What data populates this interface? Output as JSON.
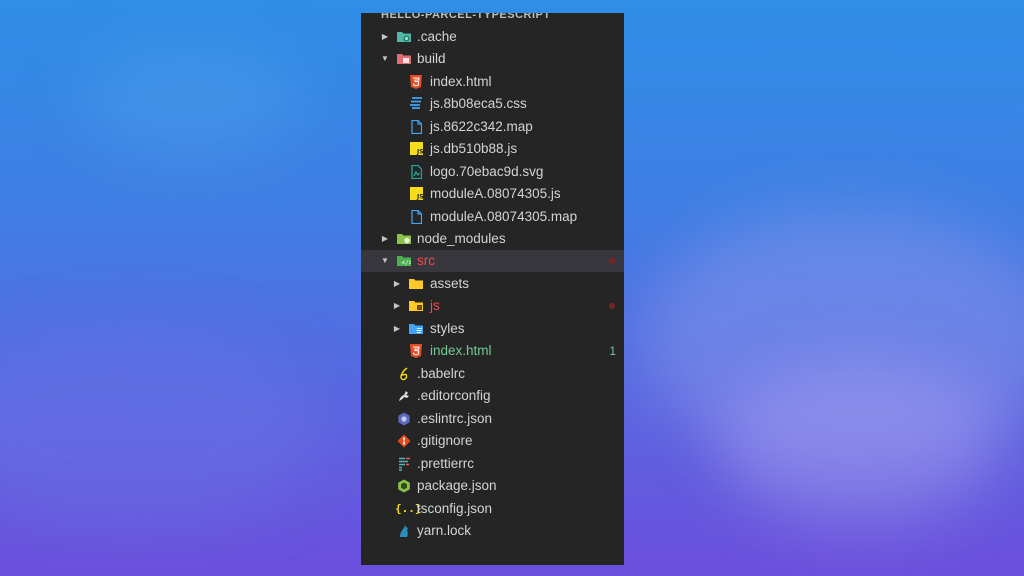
{
  "explorer": {
    "title": "HELLO-PARCEL-TYPESCRIPT",
    "items": [
      {
        "name": ".cache",
        "type": "folder",
        "twisty": "▸",
        "icon": "folder-cache-icon",
        "color": "#4fb8a8"
      },
      {
        "name": "build",
        "type": "folder",
        "twisty": "▾",
        "icon": "folder-build-icon",
        "color": "#e06c75"
      },
      {
        "name": "index.html",
        "type": "file",
        "icon": "html-icon",
        "color": "#e44d26"
      },
      {
        "name": "js.8b08eca5.css",
        "type": "file",
        "icon": "css-icon",
        "color": "#42a5f5"
      },
      {
        "name": "js.8622c342.map",
        "type": "file",
        "icon": "map-file-icon",
        "color": "#42a5f5"
      },
      {
        "name": "js.db510b88.js",
        "type": "file",
        "icon": "js-icon",
        "color": "#f5de19"
      },
      {
        "name": "logo.70ebac9d.svg",
        "type": "file",
        "icon": "svg-icon",
        "color": "#26a69a"
      },
      {
        "name": "moduleA.08074305.js",
        "type": "file",
        "icon": "js-icon",
        "color": "#f5de19"
      },
      {
        "name": "moduleA.08074305.map",
        "type": "file",
        "icon": "map-file-icon",
        "color": "#42a5f5"
      },
      {
        "name": "node_modules",
        "type": "folder",
        "twisty": "▸",
        "icon": "folder-node-icon",
        "color": "#8bc34a"
      },
      {
        "name": "src",
        "type": "folder",
        "twisty": "▾",
        "icon": "folder-src-icon",
        "color": "#4caf50",
        "status": "error"
      },
      {
        "name": "assets",
        "type": "folder",
        "twisty": "▸",
        "icon": "folder-assets-icon",
        "color": "#ffca28"
      },
      {
        "name": "js",
        "type": "folder",
        "twisty": "▸",
        "icon": "folder-js-icon",
        "color": "#ffca28",
        "status": "error"
      },
      {
        "name": "styles",
        "type": "folder",
        "twisty": "▸",
        "icon": "folder-styles-icon",
        "color": "#42a5f5"
      },
      {
        "name": "index.html",
        "type": "file",
        "icon": "html-icon",
        "color": "#e44d26",
        "status": "modified",
        "badge": "1"
      },
      {
        "name": ".babelrc",
        "type": "file",
        "icon": "babel-icon",
        "color": "#f5de19"
      },
      {
        "name": ".editorconfig",
        "type": "file",
        "icon": "editorconfig-icon",
        "color": "#e0e0e0"
      },
      {
        "name": ".eslintrc.json",
        "type": "file",
        "icon": "eslint-icon",
        "color": "#5c6bc0"
      },
      {
        "name": ".gitignore",
        "type": "file",
        "icon": "git-icon",
        "color": "#e64a19"
      },
      {
        "name": ".prettierrc",
        "type": "file",
        "icon": "prettier-icon",
        "color": "#56b3b4"
      },
      {
        "name": "package.json",
        "type": "file",
        "icon": "npm-icon",
        "color": "#8bc34a"
      },
      {
        "name": "tsconfig.json",
        "type": "file",
        "icon": "json-icon",
        "color": "#f5de19"
      },
      {
        "name": "yarn.lock",
        "type": "file",
        "icon": "yarn-icon",
        "color": "#2c8ebb"
      }
    ]
  }
}
